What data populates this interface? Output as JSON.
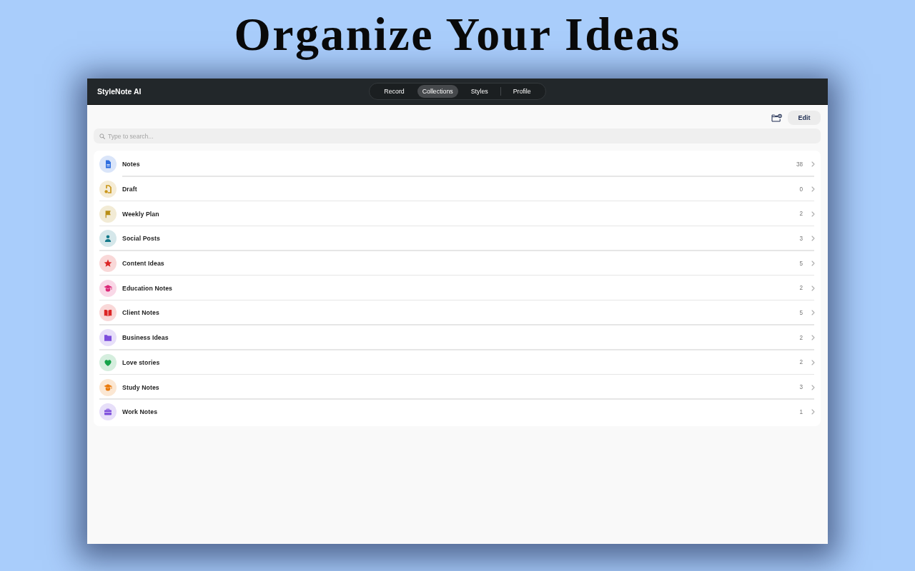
{
  "headline": "Organize Your Ideas",
  "app": {
    "title": "StyleNote AI",
    "tabs": [
      {
        "label": "Record",
        "selected": false
      },
      {
        "label": "Collections",
        "selected": true
      },
      {
        "label": "Styles",
        "selected": false
      },
      {
        "label": "Profile",
        "selected": false
      }
    ]
  },
  "toolbar": {
    "edit_button": "Edit"
  },
  "search": {
    "placeholder": "Type to search..."
  },
  "collections": [
    {
      "name": "Notes",
      "count": "38",
      "color": "#2f6fe0"
    },
    {
      "name": "Draft",
      "count": "0",
      "color": "#c9961a"
    },
    {
      "name": "Weekly Plan",
      "count": "2",
      "color": "#b98f17"
    },
    {
      "name": "Social Posts",
      "count": "3",
      "color": "#13798a"
    },
    {
      "name": "Content Ideas",
      "count": "5",
      "color": "#dc2626"
    },
    {
      "name": "Education Notes",
      "count": "2",
      "color": "#db2777"
    },
    {
      "name": "Client Notes",
      "count": "5",
      "color": "#dc2626"
    },
    {
      "name": "Business Ideas",
      "count": "2",
      "color": "#7c4ddc"
    },
    {
      "name": "Love stories",
      "count": "2",
      "color": "#16a34a"
    },
    {
      "name": "Study Notes",
      "count": "3",
      "color": "#ea7a0c"
    },
    {
      "name": "Work Notes",
      "count": "1",
      "color": "#7c4ddc"
    }
  ]
}
